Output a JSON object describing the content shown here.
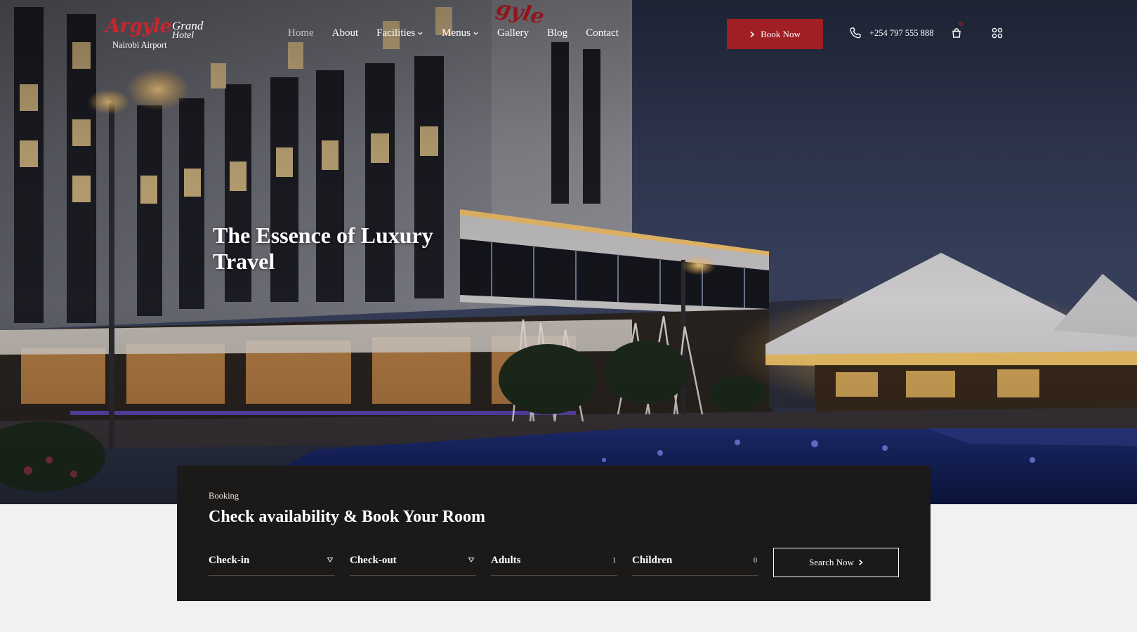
{
  "brand": {
    "name": "Argyle",
    "grand": "Grand",
    "hotel": "Hotel",
    "location": "Nairobi Airport",
    "accent_color": "#c8262c"
  },
  "nav": {
    "items": [
      {
        "label": "Home",
        "active": true,
        "dropdown": false
      },
      {
        "label": "About",
        "active": false,
        "dropdown": false
      },
      {
        "label": "Facilities",
        "active": false,
        "dropdown": true
      },
      {
        "label": "Menus",
        "active": false,
        "dropdown": true
      },
      {
        "label": "Gallery",
        "active": false,
        "dropdown": false
      },
      {
        "label": "Blog",
        "active": false,
        "dropdown": false
      },
      {
        "label": "Contact",
        "active": false,
        "dropdown": false
      }
    ]
  },
  "header": {
    "book_label": "Book Now",
    "book_color": "#a01f24",
    "phone": "+254 797 555 888",
    "cart_count": "0",
    "icons": [
      "chevron-right-icon",
      "phone-icon",
      "shopping-bag-icon",
      "grid-menu-icon"
    ]
  },
  "hero": {
    "title": "The Essence of Luxury Travel"
  },
  "booking": {
    "kicker": "Booking",
    "title": "Check availability & Book Your Room",
    "fields": [
      {
        "label": "Check-in",
        "type": "date",
        "value": ""
      },
      {
        "label": "Check-out",
        "type": "date",
        "value": ""
      },
      {
        "label": "Adults",
        "type": "number",
        "value": "1"
      },
      {
        "label": "Children",
        "type": "number",
        "value": "0"
      }
    ],
    "search_label": "Search Now",
    "panel_color": "#1c1a19"
  }
}
